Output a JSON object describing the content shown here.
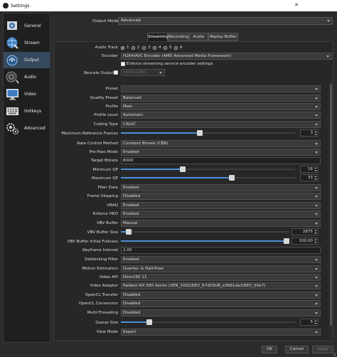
{
  "window": {
    "title": "Settings"
  },
  "sidebar": {
    "items": [
      {
        "label": "General",
        "icon": "gear-general-icon",
        "active": false
      },
      {
        "label": "Stream",
        "icon": "globe-stream-icon",
        "active": false
      },
      {
        "label": "Output",
        "icon": "satellite-dish-icon",
        "active": true
      },
      {
        "label": "Audio",
        "icon": "speaker-icon",
        "active": false
      },
      {
        "label": "Video",
        "icon": "monitor-icon",
        "active": false
      },
      {
        "label": "Hotkeys",
        "icon": "keyboard-icon",
        "active": false
      },
      {
        "label": "Advanced",
        "icon": "gears-icon",
        "active": false
      }
    ]
  },
  "output_mode": {
    "label": "Output Mode",
    "value": "Advanced"
  },
  "tabs": [
    {
      "label": "Streaming",
      "active": true
    },
    {
      "label": "Recording",
      "active": false
    },
    {
      "label": "Audio",
      "active": false
    },
    {
      "label": "Replay Buffer",
      "active": false
    }
  ],
  "streaming": {
    "audio_track": {
      "label": "Audio Track",
      "options": [
        "1",
        "2",
        "3",
        "4",
        "5",
        "6"
      ],
      "selected": "1"
    },
    "encoder": {
      "label": "Encoder",
      "value": "H264/AVC Encoder (AMD Advanced Media Framework)"
    },
    "enforce_checkbox": {
      "label": "Enforce streaming service encoder settings",
      "checked": false
    },
    "rescale": {
      "label": "Rescale Output",
      "checked": false,
      "value": "1920x1080"
    }
  },
  "encoder_settings": {
    "preset": {
      "label": "Preset",
      "value": ""
    },
    "quality_preset": {
      "label": "Quality Preset",
      "value": "Balanced"
    },
    "profile": {
      "label": "Profile",
      "value": "Main"
    },
    "profile_level": {
      "label": "Profile Level",
      "value": "Automatic"
    },
    "coding_type": {
      "label": "Coding Type",
      "value": "CALVC"
    },
    "max_ref_frames": {
      "label": "Maximum Reference Frames",
      "value": "3",
      "fraction": 0.45
    },
    "rate_control": {
      "label": "Rate Control Method",
      "value": "Constant Bitrate (CBR)"
    },
    "pre_pass": {
      "label": "Pre-Pass Mode",
      "value": "Enabled"
    },
    "target_bitrate": {
      "label": "Target Bitrate",
      "value": "8000"
    },
    "min_qp": {
      "label": "Minimum QP",
      "value": "18",
      "fraction": 0.35
    },
    "max_qp": {
      "label": "Maximum QP",
      "value": "33",
      "fraction": 0.64
    },
    "filler_data": {
      "label": "Filler Data",
      "value": "Enabled"
    },
    "frame_skipping": {
      "label": "Frame Skipping",
      "value": "Disabled"
    },
    "vbaq": {
      "label": "VBAQ",
      "value": "Enabled"
    },
    "enforce_hrd": {
      "label": "Enforce HRD",
      "value": "Enabled"
    },
    "vbv_buffer": {
      "label": "VBV Buffer",
      "value": "Manual"
    },
    "vbv_buffer_size": {
      "label": "VBV Buffer Size",
      "value": "2875",
      "fraction": 0.03
    },
    "vbv_initial": {
      "label": "VBV Buffer Initial Fullness",
      "value": "100.00",
      "fraction": 1.0
    },
    "keyframe_interval": {
      "label": "Keyframe Interval",
      "value": "2.00"
    },
    "deblocking": {
      "label": "Deblocking Filter",
      "value": "Enabled"
    },
    "motion_estimation": {
      "label": "Motion Estimation",
      "value": "Quarter- & Half-Pixel"
    },
    "video_api": {
      "label": "Video API",
      "value": "Direct3D 11"
    },
    "video_adapter": {
      "label": "Video Adapter",
      "value": "Radeon RX 580 Series (VEN_1002/DEV_67df/SUB_e3661da2/REV_00e7)"
    },
    "opencl_transfer": {
      "label": "OpenCL Transfer",
      "value": "Disabled"
    },
    "opencl_conversion": {
      "label": "OpenCL Conversion",
      "value": "Disabled"
    },
    "multithreading": {
      "label": "Multi-Threading",
      "value": "Disabled"
    },
    "queue_size": {
      "label": "Queue Size",
      "value": "5",
      "fraction": 0.15
    },
    "view_mode": {
      "label": "View Mode",
      "value": "Expert"
    }
  },
  "footer": {
    "ok": "OK",
    "cancel": "Cancel",
    "apply": "Apply"
  },
  "colors": {
    "accent": "#4a8fd8",
    "active_nav": "#35495e",
    "background": "#2b2b2b"
  }
}
